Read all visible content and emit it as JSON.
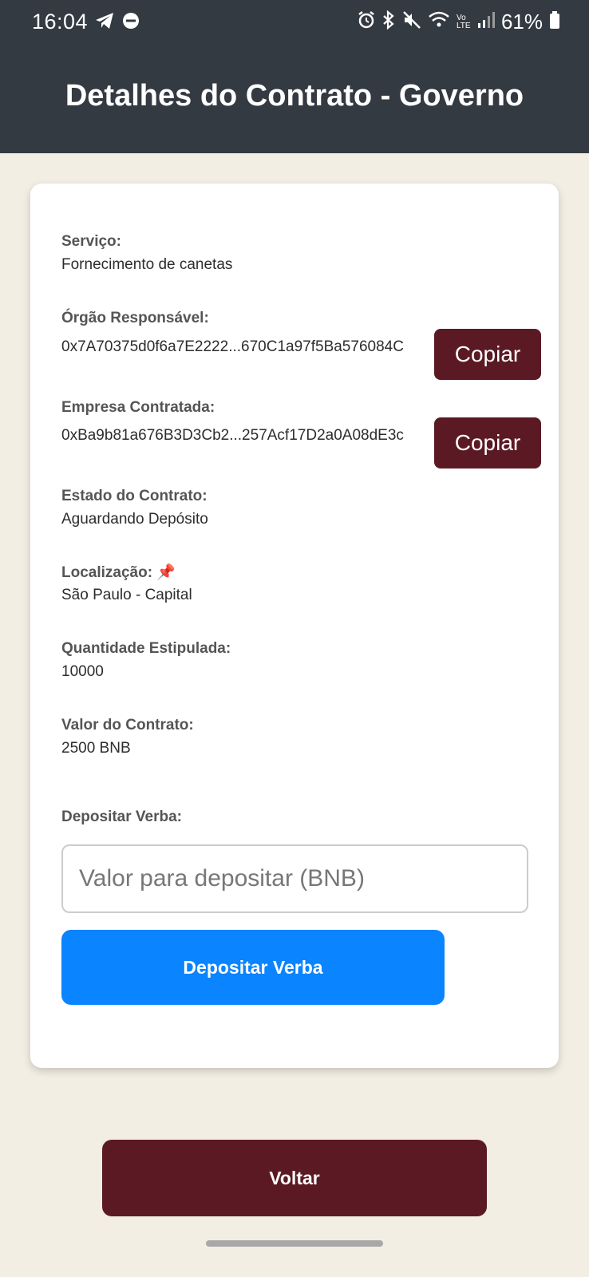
{
  "status_bar": {
    "time": "16:04",
    "battery": "61%",
    "icons_left": [
      "telegram-icon",
      "do-not-disturb-icon"
    ],
    "icons_right": [
      "alarm-icon",
      "bluetooth-icon",
      "mute-icon",
      "wifi-icon",
      "volte-icon",
      "signal-icon",
      "battery-icon"
    ],
    "volte_label": "Vo LTE"
  },
  "header": {
    "title": "Detalhes do Contrato - Governo"
  },
  "contract": {
    "service_label": "Serviço:",
    "service_value": "Fornecimento de canetas",
    "agency_label": "Órgão Responsável:",
    "agency_value": "0x7A70375d0f6a7E2222...670C1a97f5Ba576084C",
    "company_label": "Empresa Contratada:",
    "company_value": "0xBa9b81a676B3D3Cb2...257Acf17D2a0A08dE3c",
    "copy_label": "Copiar",
    "state_label": "Estado do Contrato:",
    "state_value": "Aguardando Depósito",
    "location_label": "Localização:",
    "location_icon": "📌",
    "location_value": "São Paulo - Capital",
    "quantity_label": "Quantidade Estipulada:",
    "quantity_value": "10000",
    "value_label": "Valor do Contrato:",
    "value_value": "2500 BNB"
  },
  "deposit": {
    "label": "Depositar Verba:",
    "placeholder": "Valor para depositar (BNB)",
    "button_label": "Depositar Verba"
  },
  "back_button": "Voltar",
  "colors": {
    "header_bg": "#343a42",
    "page_bg": "#f2eee3",
    "accent_dark_red": "#5b1a23",
    "primary_blue": "#0a84ff"
  }
}
